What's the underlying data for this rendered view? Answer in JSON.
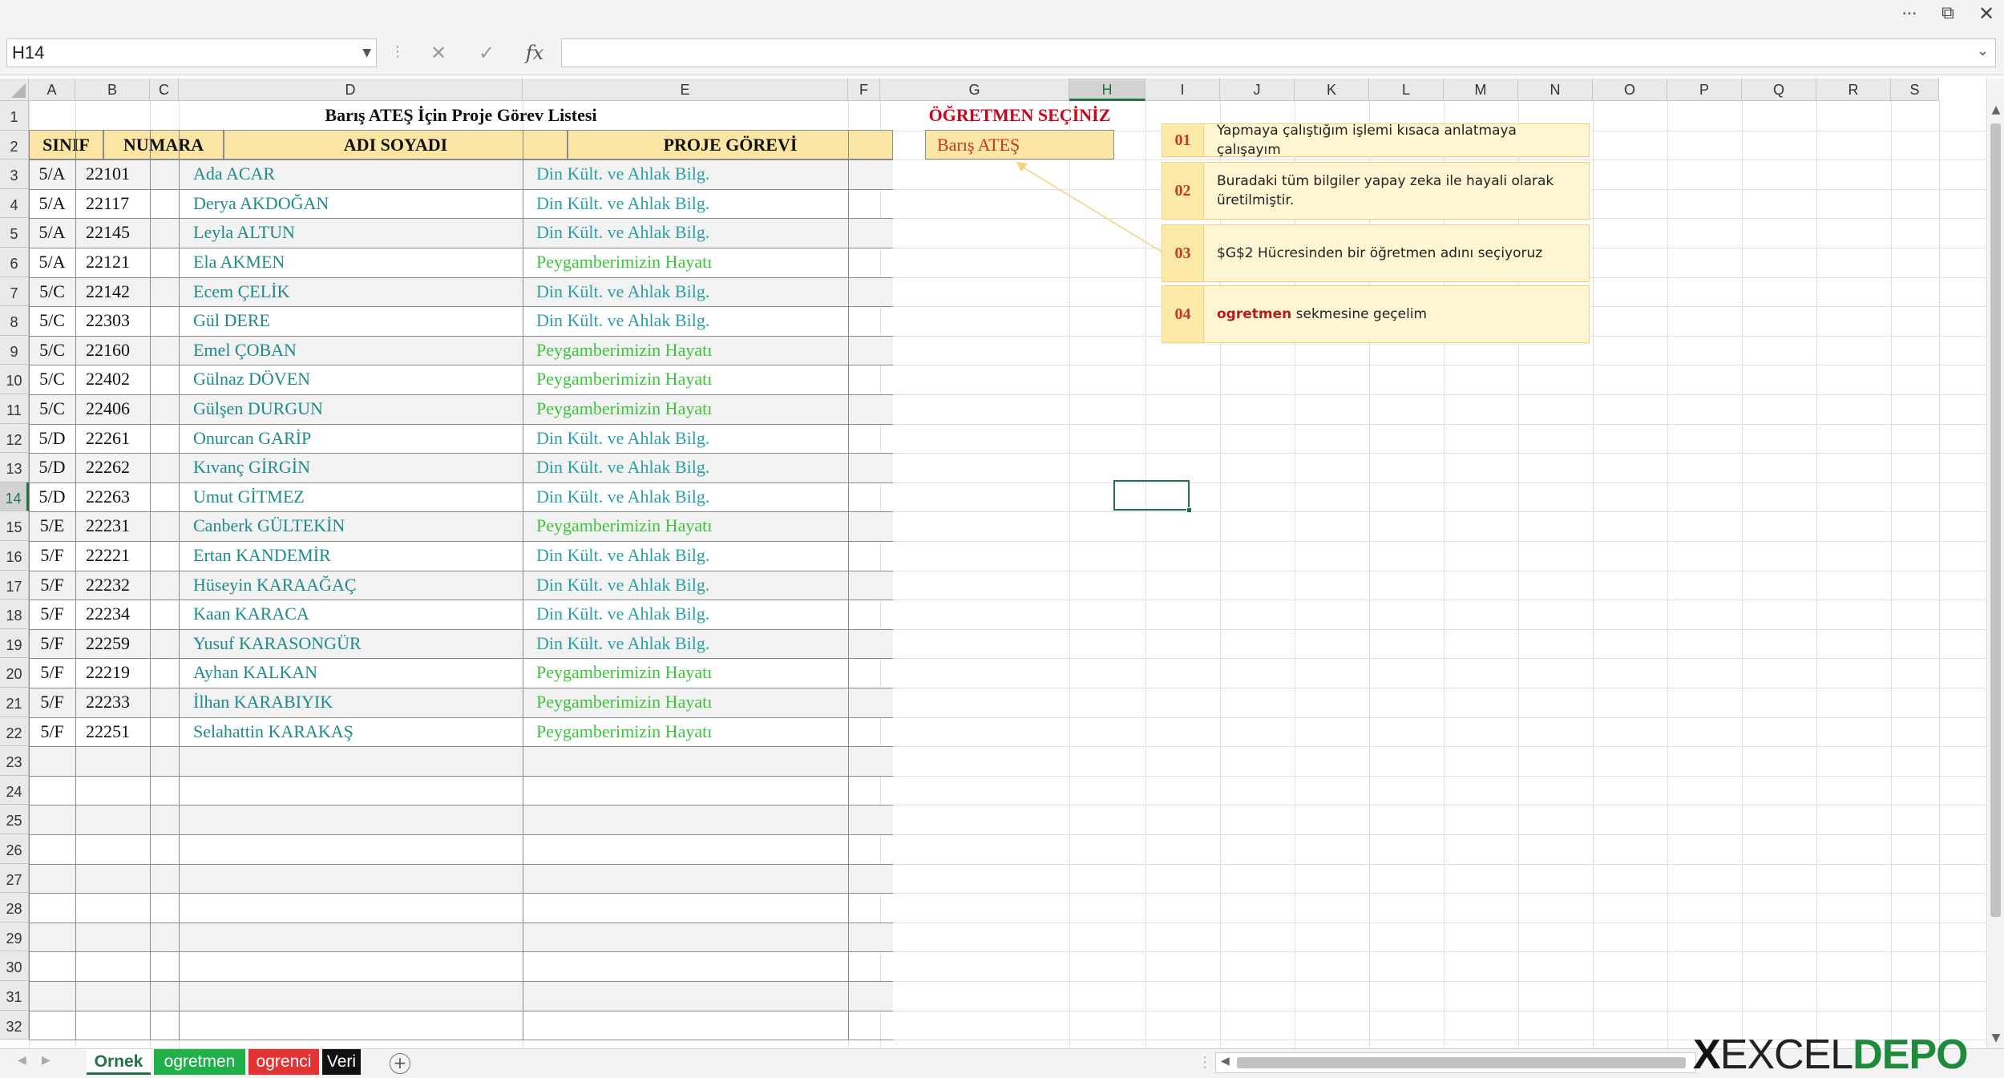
{
  "app": {
    "colors": {
      "accent": "#217346",
      "header_fill": "#fbe6a6",
      "name_color": "#1e8a8a",
      "task_teal": "#2aa0a6",
      "task_green": "#3bc43b",
      "label_red": "#d0021b"
    }
  },
  "formula_bar": {
    "name_box": "H14",
    "formula": ""
  },
  "columns": [
    "A",
    "B",
    "C",
    "D",
    "E",
    "F",
    "G",
    "H",
    "I",
    "J",
    "K",
    "L",
    "M",
    "N",
    "O",
    "P",
    "Q",
    "R",
    "S"
  ],
  "rows": [
    "1",
    "2",
    "3",
    "4",
    "5",
    "6",
    "7",
    "8",
    "9",
    "10",
    "11",
    "12",
    "13",
    "14",
    "15",
    "16",
    "17",
    "18",
    "19",
    "20",
    "21",
    "22",
    "23",
    "24",
    "25",
    "26",
    "27",
    "28",
    "29",
    "30",
    "31",
    "32"
  ],
  "sheet": {
    "title": "Barış ATEŞ İçin Proje Görev Listesi",
    "headers": {
      "sinif": "SINIF",
      "numara": "NUMARA",
      "adi_soyadi": "ADI SOYADI",
      "proje_gorevi": "PROJE GÖREVİ"
    },
    "students": [
      {
        "sinif": "5/A",
        "numara": "22101",
        "ad": "Ada ACAR",
        "gorev": "Din Kült. ve Ahlak Bilg."
      },
      {
        "sinif": "5/A",
        "numara": "22117",
        "ad": "Derya AKDOĞAN",
        "gorev": "Din Kült. ve Ahlak Bilg."
      },
      {
        "sinif": "5/A",
        "numara": "22145",
        "ad": "Leyla ALTUN",
        "gorev": "Din Kült. ve Ahlak Bilg."
      },
      {
        "sinif": "5/A",
        "numara": "22121",
        "ad": "Ela AKMEN",
        "gorev": "Peygamberimizin Hayatı"
      },
      {
        "sinif": "5/C",
        "numara": "22142",
        "ad": "Ecem ÇELİK",
        "gorev": "Din Kült. ve Ahlak Bilg."
      },
      {
        "sinif": "5/C",
        "numara": "22303",
        "ad": "Gül DERE",
        "gorev": "Din Kült. ve Ahlak Bilg."
      },
      {
        "sinif": "5/C",
        "numara": "22160",
        "ad": "Emel ÇOBAN",
        "gorev": "Peygamberimizin Hayatı"
      },
      {
        "sinif": "5/C",
        "numara": "22402",
        "ad": "Gülnaz DÖVEN",
        "gorev": "Peygamberimizin Hayatı"
      },
      {
        "sinif": "5/C",
        "numara": "22406",
        "ad": "Gülşen DURGUN",
        "gorev": "Peygamberimizin Hayatı"
      },
      {
        "sinif": "5/D",
        "numara": "22261",
        "ad": "Onurcan GARİP",
        "gorev": "Din Kült. ve Ahlak Bilg."
      },
      {
        "sinif": "5/D",
        "numara": "22262",
        "ad": "Kıvanç GİRGİN",
        "gorev": "Din Kült. ve Ahlak Bilg."
      },
      {
        "sinif": "5/D",
        "numara": "22263",
        "ad": "Umut GİTMEZ",
        "gorev": "Din Kült. ve Ahlak Bilg."
      },
      {
        "sinif": "5/E",
        "numara": "22231",
        "ad": "Canberk GÜLTEKİN",
        "gorev": "Peygamberimizin Hayatı"
      },
      {
        "sinif": "5/F",
        "numara": "22221",
        "ad": "Ertan KANDEMİR",
        "gorev": "Din Kült. ve Ahlak Bilg."
      },
      {
        "sinif": "5/F",
        "numara": "22232",
        "ad": "Hüseyin KARAAĞAÇ",
        "gorev": "Din Kült. ve Ahlak Bilg."
      },
      {
        "sinif": "5/F",
        "numara": "22234",
        "ad": "Kaan KARACA",
        "gorev": "Din Kült. ve Ahlak Bilg."
      },
      {
        "sinif": "5/F",
        "numara": "22259",
        "ad": "Yusuf KARASONGÜR",
        "gorev": "Din Kült. ve Ahlak Bilg."
      },
      {
        "sinif": "5/F",
        "numara": "22219",
        "ad": "Ayhan KALKAN",
        "gorev": "Peygamberimizin Hayatı"
      },
      {
        "sinif": "5/F",
        "numara": "22233",
        "ad": "İlhan KARABIYIK",
        "gorev": "Peygamberimizin Hayatı"
      },
      {
        "sinif": "5/F",
        "numara": "22251",
        "ad": "Selahattin KARAKAŞ",
        "gorev": "Peygamberimizin Hayatı"
      }
    ],
    "ogretmen_label": "ÖĞRETMEN SEÇİNİZ",
    "ogretmen_value": "Barış ATEŞ"
  },
  "notes": [
    {
      "num": "01",
      "text": "Yapmaya çalıştığım işlemi kısaca anlatmaya çalışayım"
    },
    {
      "num": "02",
      "text": "Buradaki tüm bilgiler yapay zeka ile hayali olarak üretilmiştir."
    },
    {
      "num": "03",
      "text": "$G$2 Hücresinden bir öğretmen adını seçiyoruz"
    },
    {
      "num": "04",
      "emphasis": "ogretmen",
      "text": " sekmesine geçelim"
    }
  ],
  "tabs": [
    {
      "label": "Ornek",
      "bg": "#ffffff",
      "fg": "#217346"
    },
    {
      "label": "ogretmen",
      "bg": "#1fb04a",
      "fg": "#ffffff"
    },
    {
      "label": "ogrenci",
      "bg": "#e53232",
      "fg": "#ffffff"
    },
    {
      "label": "Veri",
      "bg": "#111111",
      "fg": "#ffffff"
    }
  ],
  "logo": {
    "x": "X",
    "excel": "EXCEL",
    "depo": "DEPO"
  }
}
